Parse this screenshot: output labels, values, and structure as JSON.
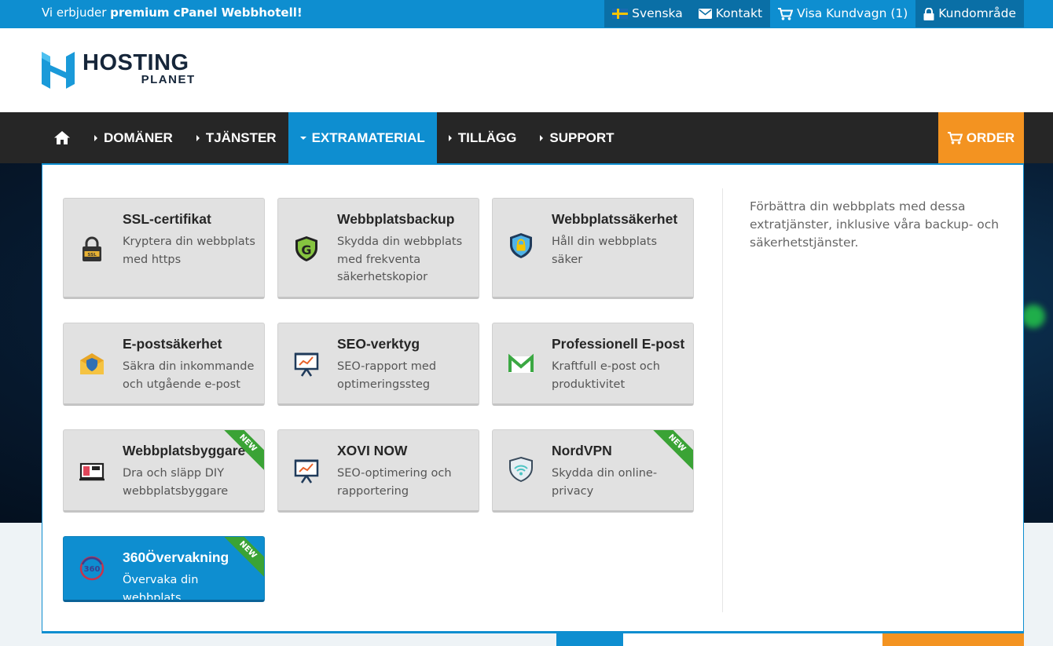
{
  "topbar": {
    "promo_prefix": "Vi erbjuder ",
    "promo_bold": "premium cPanel Webbhotell!",
    "language": "Svenska",
    "contact": "Kontakt",
    "cart": "Visa Kundvagn (1)",
    "client_area": "Kundområde"
  },
  "logo": {
    "line1": "HOSTING",
    "line2": "PLANET"
  },
  "nav": {
    "items": [
      {
        "label": "DOMÄNER"
      },
      {
        "label": "TJÄNSTER"
      },
      {
        "label": "EXTRAMATERIAL"
      },
      {
        "label": "TILLÄGG"
      },
      {
        "label": "SUPPORT"
      }
    ],
    "order": "ORDER"
  },
  "mega": {
    "description": "Förbättra din webbplats med dessa extratjänster, inklusive våra backup- och säkerhetstjänster.",
    "cards": [
      {
        "title": "SSL-certifikat",
        "sub": "Kryptera din webbplats med https",
        "icon": "ssl-lock-icon"
      },
      {
        "title": "Webbplatsbackup",
        "sub": "Skydda din webbplats med frekventa säkerhetskopior",
        "icon": "backup-shield-icon"
      },
      {
        "title": "Webbplatssäkerhet",
        "sub": "Håll din webbplats säker",
        "icon": "security-shield-icon"
      },
      {
        "title": "E-postsäkerhet",
        "sub": "Säkra din inkommande och utgående e-post",
        "icon": "email-security-icon"
      },
      {
        "title": "SEO-verktyg",
        "sub": "SEO-rapport med optimeringssteg",
        "icon": "seo-chart-icon"
      },
      {
        "title": "Professionell E-post",
        "sub": "Kraftfull e-post och produktivitet",
        "icon": "mail-m-icon"
      },
      {
        "title": "Webbplatsbyggare",
        "sub": "Dra och släpp DIY webbplatsbyggare",
        "icon": "site-builder-icon",
        "badge": "NEW"
      },
      {
        "title": "XOVI NOW",
        "sub": "SEO-optimering och rapportering",
        "icon": "seo-chart-icon",
        "badge": ""
      },
      {
        "title": "NordVPN",
        "sub": "Skydda din online-privacy",
        "icon": "vpn-shield-icon",
        "badge": "NEW"
      },
      {
        "title": "360Övervakning",
        "sub": "Övervaka din webbplats",
        "icon": "monitor-360-icon",
        "badge": "NEW"
      }
    ]
  },
  "colors": {
    "primary": "#0e8ed0",
    "accent": "#f39321",
    "nav_bg": "#262626",
    "badge": "#3aa335"
  }
}
